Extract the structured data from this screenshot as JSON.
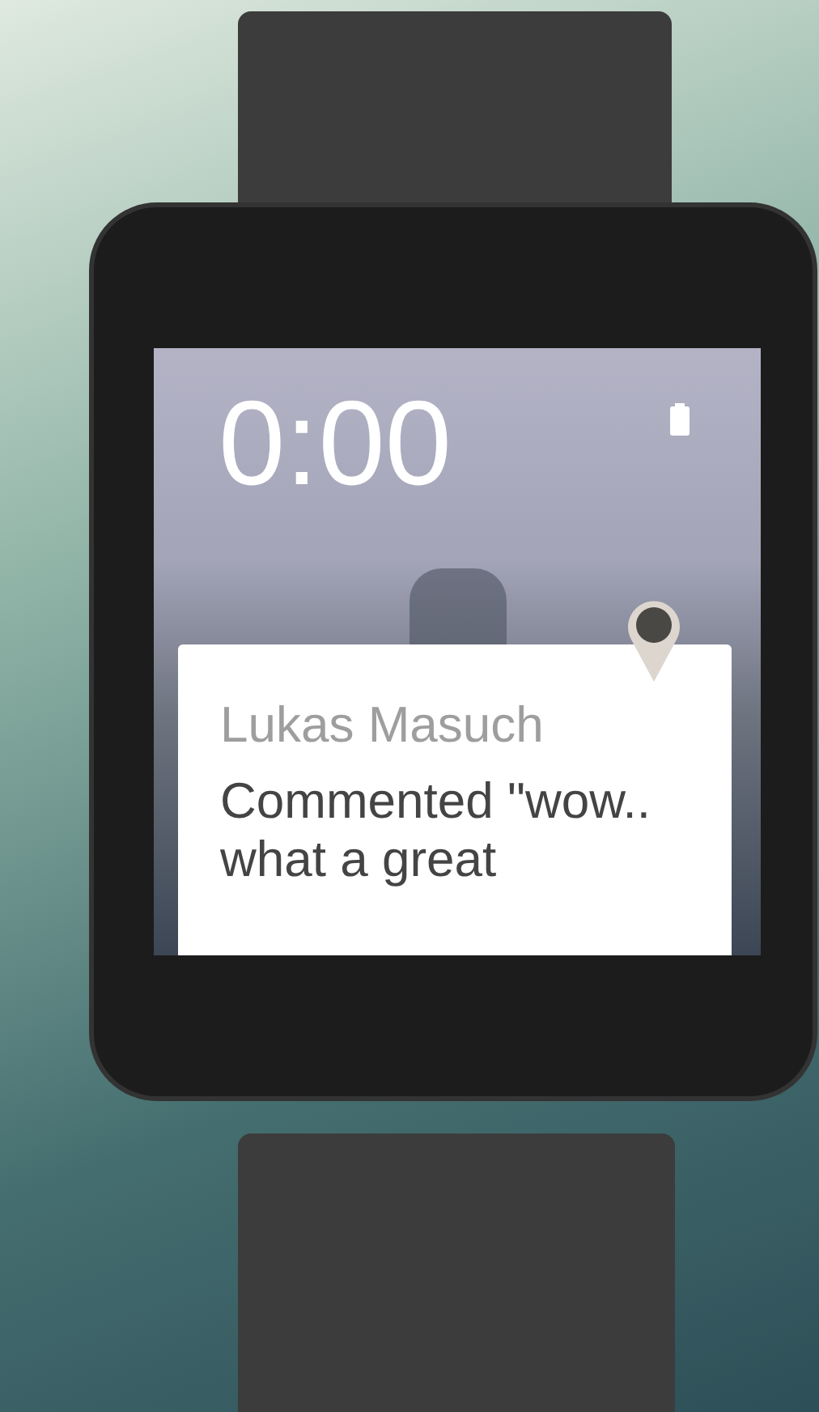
{
  "watch_face": {
    "time": "0:00"
  },
  "notification": {
    "sender": "Lukas Masuch",
    "message": "Commented \"wow.. what a great"
  }
}
